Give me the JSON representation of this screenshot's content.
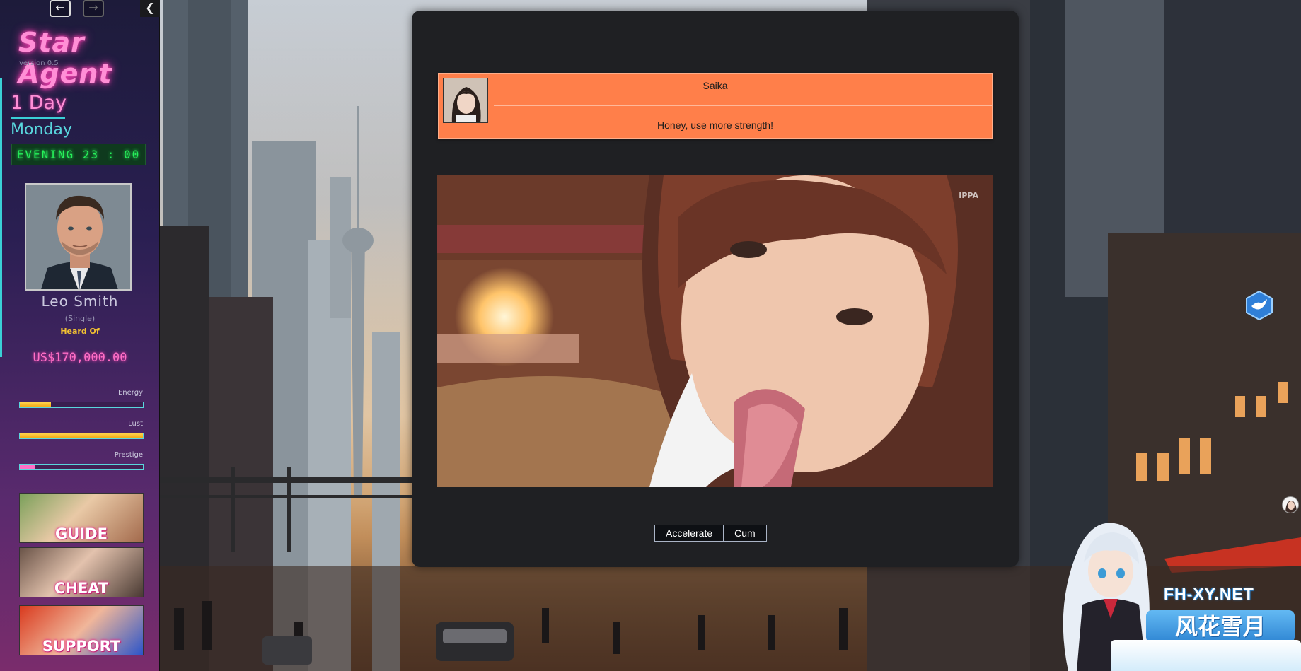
{
  "sidebar": {
    "nav_back_icon": "arrow-left-icon",
    "nav_forward_icon": "arrow-right-icon",
    "collapse_icon": "chevron-left-icon",
    "logo": "Star Agent",
    "version": "version 0.5",
    "day": "1 Day",
    "weekday": "Monday",
    "clock": "EVENING 23 : 00",
    "player": {
      "name": "Leo Smith",
      "status": "(Single)",
      "title": "Heard Of",
      "money": "US$170,000.00"
    },
    "stats": [
      {
        "label": "Energy",
        "value": 0.25
      },
      {
        "label": "Lust",
        "value": 1.0
      },
      {
        "label": "Prestige",
        "value": 0.12
      }
    ],
    "promos": [
      {
        "label": "GUIDE"
      },
      {
        "label": "CHEAT"
      },
      {
        "label": "SUPPORT"
      }
    ]
  },
  "dialog": {
    "speaker": "Saika",
    "text": "Honey, use more strength!",
    "scene_watermark": "IPPA",
    "actions": [
      {
        "label": "Accelerate"
      },
      {
        "label": "Cum"
      }
    ]
  },
  "overlay": {
    "brand_url": "FH-XY.NET",
    "brand_cn": "风花雪月"
  },
  "colors": {
    "speech_bg": "#ff7f4a",
    "logo_pink": "#ff8ed6",
    "accent_cyan": "#3ad0d6",
    "clock_green": "#26f05a",
    "stat_yellow": "#f2a30f"
  }
}
